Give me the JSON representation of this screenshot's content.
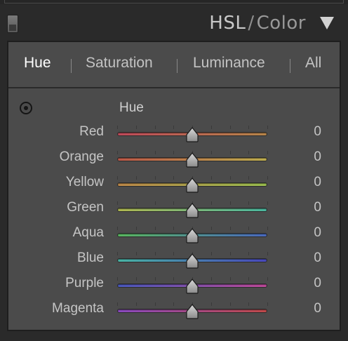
{
  "header": {
    "title_main": "HSL",
    "title_sep": "/",
    "title_alt": "Color"
  },
  "tabs": [
    {
      "label": "Hue",
      "active": true
    },
    {
      "label": "Saturation",
      "active": false
    },
    {
      "label": "Luminance",
      "active": false
    },
    {
      "label": "All",
      "active": false
    }
  ],
  "section": {
    "label": "Hue"
  },
  "sliders": [
    {
      "label": "Red",
      "value": "0",
      "position": 0.5,
      "c1": "#c04a5a",
      "c2": "#b8864a"
    },
    {
      "label": "Orange",
      "value": "0",
      "position": 0.5,
      "c1": "#c05a4a",
      "c2": "#c0b050"
    },
    {
      "label": "Yellow",
      "value": "0",
      "position": 0.5,
      "c1": "#c08a4a",
      "c2": "#9cc050"
    },
    {
      "label": "Green",
      "value": "0",
      "position": 0.5,
      "c1": "#b0b850",
      "c2": "#4ab8a0"
    },
    {
      "label": "Aqua",
      "value": "0",
      "position": 0.5,
      "c1": "#5ab860",
      "c2": "#4a6ac0"
    },
    {
      "label": "Blue",
      "value": "0",
      "position": 0.5,
      "c1": "#4ab8a8",
      "c2": "#4a4ac0"
    },
    {
      "label": "Purple",
      "value": "0",
      "position": 0.5,
      "c1": "#4a5ac0",
      "c2": "#c04a9a"
    },
    {
      "label": "Magenta",
      "value": "0",
      "position": 0.5,
      "c1": "#8a4ac0",
      "c2": "#c04a4a"
    }
  ]
}
